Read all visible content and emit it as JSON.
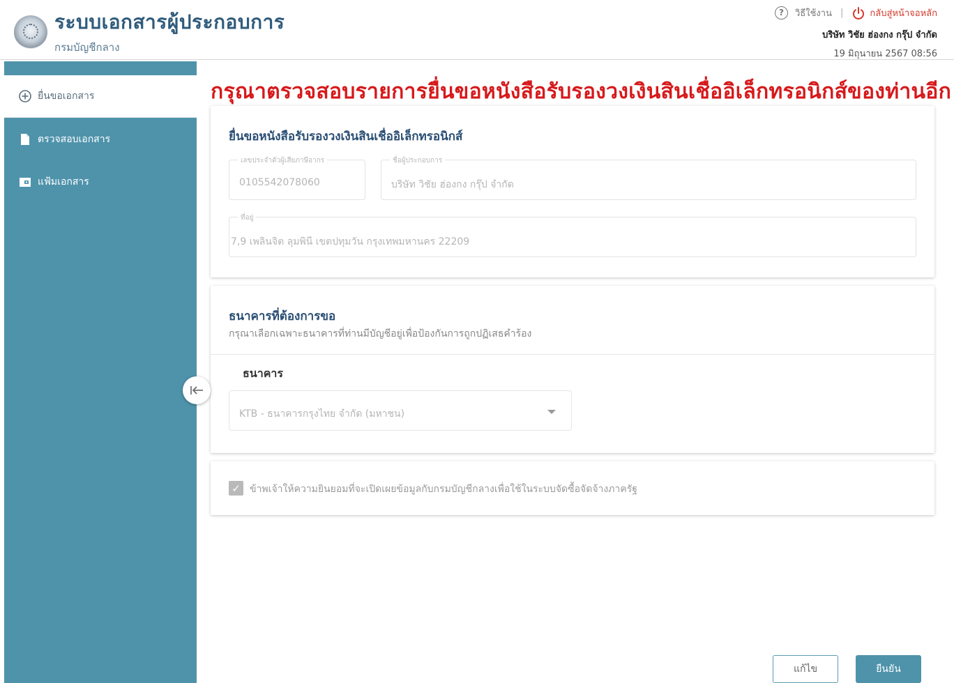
{
  "header": {
    "app_title": "ระบบเอกสารผู้ประกอบการ",
    "app_subtitle": "กรมบัญชีกลาง",
    "help_label": "วิธีใช้งาน",
    "home_label": "กลับสู่หน้าจอหลัก",
    "company": "บริษัท วิชัย ฮ่องกง กรุ๊ป จำกัด",
    "datetime": "19 มิถุนายน 2567 08:56"
  },
  "sidebar": {
    "items": [
      {
        "label": "ยื่นขอเอกสาร",
        "icon": "plus-circle-icon",
        "active": true
      },
      {
        "label": "ตรวจสอบเอกสาร",
        "icon": "document-icon",
        "active": false
      },
      {
        "label": "แฟ้มเอกสาร",
        "icon": "wallet-icon",
        "active": false
      }
    ]
  },
  "main": {
    "heading": "กรุณาตรวจสอบรายการยื่นขอหนังสือรับรองวงเงินสินเชื่ออิเล็กทรอนิกส์ของท่านอีกครั้ง",
    "applicant": {
      "title": "ยื่นขอหนังสือรับรองวงเงินสินเชื่ออิเล็กทรอนิกส์",
      "tax_id_label": "เลขประจำตัวผู้เสียภาษีอากร",
      "tax_id_value": "0105542078060",
      "name_label": "ชื่อผู้ประกอบการ",
      "name_value": "บริษัท วิชัย ฮ่องกง กรุ๊ป จำกัด",
      "address_label": "ที่อยู่",
      "address_value": "7,9 เพลินจิต ลุมพินี เขตปทุมวัน กรุงเทพมหานคร 22209"
    },
    "bank": {
      "title": "ธนาคารที่ต้องการขอ",
      "description": "กรุณาเลือกเฉพาะธนาคารที่ท่านมีบัญชีอยู่เพื่อป้องกันการถูกปฏิเสธคำร้อง",
      "label": "ธนาคาร",
      "selected": "KTB - ธนาคารกรุงไทย จำกัด (มหาชน)"
    },
    "consent": {
      "text": "ข้าพเจ้าให้ความยินยอมที่จะเปิดเผยข้อมูลกับกรมบัญชีกลางเพื่อใช้ในระบบจัดซื้อจัดจ้างภาครัฐ",
      "checked": true
    }
  },
  "footer": {
    "edit_label": "แก้ไข",
    "confirm_label": "ยืนยัน"
  },
  "colors": {
    "sidebar": "#4f93ab",
    "heading": "#d6191b",
    "title": "#2f5b7c"
  }
}
